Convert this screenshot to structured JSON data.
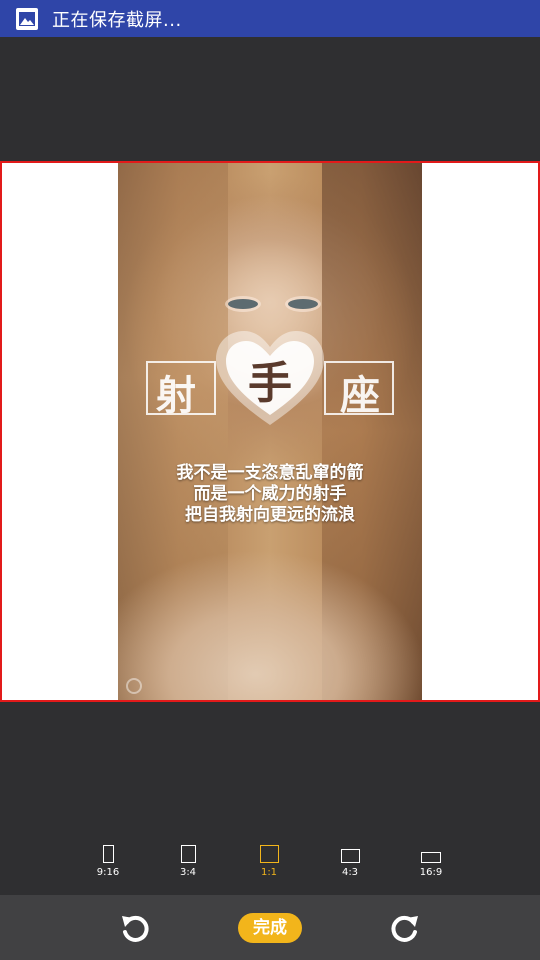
{
  "status": {
    "icon": "image-icon",
    "text": "正在保存截屏..."
  },
  "image": {
    "zodiac_left": "射",
    "zodiac_center": "手",
    "zodiac_right": "座",
    "poem": [
      "我不是一支恣意乱窜的箭",
      "而是一个威力的射手",
      "把自我射向更远的流浪"
    ]
  },
  "ratios": [
    {
      "label": "9:16"
    },
    {
      "label": "3:4"
    },
    {
      "label": "1:1"
    },
    {
      "label": "4:3"
    },
    {
      "label": "16:9"
    }
  ],
  "selected_ratio": "1:1",
  "toolbar": {
    "undo_icon": "undo-icon",
    "done_label": "完成",
    "redo_icon": "redo-icon"
  },
  "colors": {
    "status_bar": "#2f45a8",
    "crop_border": "#e21a1a",
    "accent": "#f2b51b",
    "background": "#2f2f31",
    "bottom_bar": "#414143"
  }
}
